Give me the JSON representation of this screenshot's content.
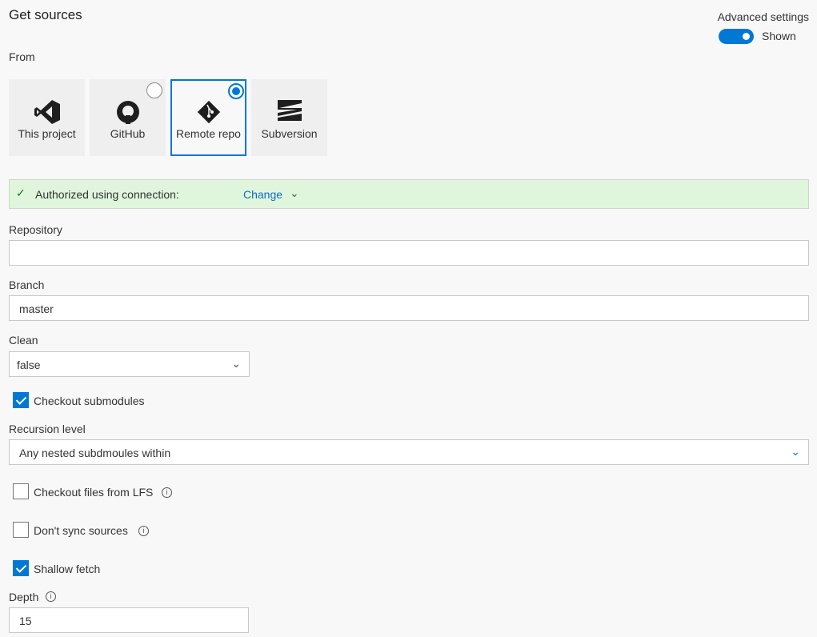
{
  "title": "Get sources",
  "advanced": {
    "label": "Advanced settings",
    "state": "Shown",
    "on": true
  },
  "from_label": "From",
  "sources": [
    {
      "label": "This project",
      "icon": "visual-studio-icon"
    },
    {
      "label": "GitHub",
      "icon": "github-icon"
    },
    {
      "label": "Remote repo",
      "icon": "git-icon",
      "selected": true
    },
    {
      "label": "Subversion",
      "icon": "subversion-icon"
    }
  ],
  "auth": {
    "text": "Authorized using connection:",
    "change": "Change"
  },
  "repository": {
    "label": "Repository",
    "value": ""
  },
  "branch": {
    "label": "Branch",
    "value": "master"
  },
  "clean": {
    "label": "Clean",
    "value": "false"
  },
  "checkout_submodules": {
    "label": "Checkout submodules",
    "checked": true
  },
  "recursion": {
    "label": "Recursion level",
    "value": "Any nested subdmoules within"
  },
  "lfs": {
    "label": "Checkout files from LFS",
    "checked": false
  },
  "dont_sync": {
    "label": "Don't sync sources",
    "checked": false
  },
  "shallow": {
    "label": "Shallow fetch",
    "checked": true
  },
  "depth": {
    "label": "Depth",
    "value": "15"
  },
  "colors": {
    "accent": "#0078d4",
    "success_bg": "#dff6dd"
  }
}
